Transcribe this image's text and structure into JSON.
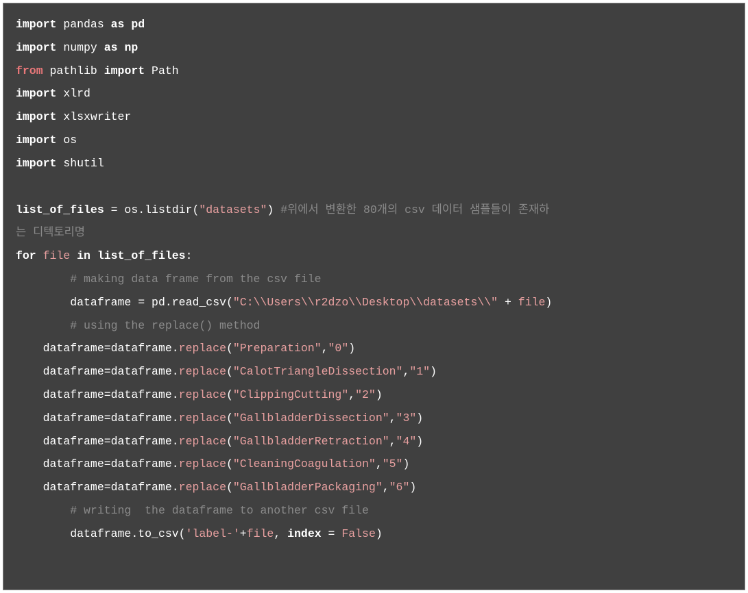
{
  "code": {
    "lines": [
      {
        "indent": "",
        "tokens": [
          {
            "cls": "kw-import",
            "t": "import"
          },
          {
            "cls": "ident",
            "t": " pandas "
          },
          {
            "cls": "kw-as",
            "t": "as"
          },
          {
            "cls": "alias",
            "t": " pd"
          }
        ]
      },
      {
        "indent": "",
        "tokens": [
          {
            "cls": "kw-import",
            "t": "import"
          },
          {
            "cls": "ident",
            "t": " numpy "
          },
          {
            "cls": "kw-as",
            "t": "as"
          },
          {
            "cls": "alias",
            "t": " np"
          }
        ]
      },
      {
        "indent": "",
        "tokens": [
          {
            "cls": "kw-from",
            "t": "from"
          },
          {
            "cls": "ident",
            "t": " pathlib "
          },
          {
            "cls": "kw-import",
            "t": "import"
          },
          {
            "cls": "ident",
            "t": " Path"
          }
        ]
      },
      {
        "indent": "",
        "tokens": [
          {
            "cls": "kw-import",
            "t": "import"
          },
          {
            "cls": "ident",
            "t": " xlrd"
          }
        ]
      },
      {
        "indent": "",
        "tokens": [
          {
            "cls": "kw-import",
            "t": "import"
          },
          {
            "cls": "ident",
            "t": " xlsxwriter"
          }
        ]
      },
      {
        "indent": "",
        "tokens": [
          {
            "cls": "kw-import",
            "t": "import"
          },
          {
            "cls": "ident",
            "t": " os"
          }
        ]
      },
      {
        "indent": "",
        "tokens": [
          {
            "cls": "kw-import",
            "t": "import"
          },
          {
            "cls": "ident",
            "t": " shutil"
          }
        ]
      },
      {
        "indent": "",
        "tokens": []
      },
      {
        "indent": "",
        "tokens": [
          {
            "cls": "ident-bold",
            "t": "list_of_files "
          },
          {
            "cls": "op",
            "t": "="
          },
          {
            "cls": "ident",
            "t": " os"
          },
          {
            "cls": "punct",
            "t": "."
          },
          {
            "cls": "ident",
            "t": "listdir"
          },
          {
            "cls": "paren",
            "t": "("
          },
          {
            "cls": "string",
            "t": "\"datasets\""
          },
          {
            "cls": "paren",
            "t": ")"
          },
          {
            "cls": "ident",
            "t": " "
          },
          {
            "cls": "comment",
            "t": "#위에서 변환한 80개의 csv 데이터 샘플들이 존재하"
          }
        ]
      },
      {
        "indent": "",
        "tokens": [
          {
            "cls": "comment",
            "t": "는 디텍토리명"
          }
        ]
      },
      {
        "indent": "",
        "tokens": [
          {
            "cls": "kw-for",
            "t": "for"
          },
          {
            "cls": "ident",
            "t": " "
          },
          {
            "cls": "var-file",
            "t": "file"
          },
          {
            "cls": "ident",
            "t": " "
          },
          {
            "cls": "kw-in",
            "t": "in"
          },
          {
            "cls": "ident-bold",
            "t": " list_of_files"
          },
          {
            "cls": "punct",
            "t": ":"
          }
        ]
      },
      {
        "indent": "        ",
        "tokens": [
          {
            "cls": "comment",
            "t": "# making data frame from the csv file"
          }
        ]
      },
      {
        "indent": "        ",
        "tokens": [
          {
            "cls": "ident",
            "t": "dataframe "
          },
          {
            "cls": "op",
            "t": "="
          },
          {
            "cls": "ident",
            "t": " pd"
          },
          {
            "cls": "punct",
            "t": "."
          },
          {
            "cls": "ident",
            "t": "read_csv"
          },
          {
            "cls": "paren",
            "t": "("
          },
          {
            "cls": "string",
            "t": "\"C:\\\\Users\\\\r2dzo\\\\Desktop\\\\datasets\\\\\""
          },
          {
            "cls": "ident",
            "t": " "
          },
          {
            "cls": "op",
            "t": "+"
          },
          {
            "cls": "ident",
            "t": " "
          },
          {
            "cls": "var-file",
            "t": "file"
          },
          {
            "cls": "paren",
            "t": ")"
          }
        ]
      },
      {
        "indent": "        ",
        "tokens": [
          {
            "cls": "comment",
            "t": "# using the replace() method"
          }
        ]
      },
      {
        "indent": "    ",
        "tokens": [
          {
            "cls": "ident",
            "t": "dataframe"
          },
          {
            "cls": "op",
            "t": "="
          },
          {
            "cls": "ident",
            "t": "dataframe"
          },
          {
            "cls": "punct",
            "t": "."
          },
          {
            "cls": "method",
            "t": "replace"
          },
          {
            "cls": "paren",
            "t": "("
          },
          {
            "cls": "string",
            "t": "\"Preparation\""
          },
          {
            "cls": "punct",
            "t": ","
          },
          {
            "cls": "string",
            "t": "\"0\""
          },
          {
            "cls": "paren",
            "t": ")"
          }
        ]
      },
      {
        "indent": "    ",
        "tokens": [
          {
            "cls": "ident",
            "t": "dataframe"
          },
          {
            "cls": "op",
            "t": "="
          },
          {
            "cls": "ident",
            "t": "dataframe"
          },
          {
            "cls": "punct",
            "t": "."
          },
          {
            "cls": "method",
            "t": "replace"
          },
          {
            "cls": "paren",
            "t": "("
          },
          {
            "cls": "string",
            "t": "\"CalotTriangleDissection\""
          },
          {
            "cls": "punct",
            "t": ","
          },
          {
            "cls": "string",
            "t": "\"1\""
          },
          {
            "cls": "paren",
            "t": ")"
          }
        ]
      },
      {
        "indent": "    ",
        "tokens": [
          {
            "cls": "ident",
            "t": "dataframe"
          },
          {
            "cls": "op",
            "t": "="
          },
          {
            "cls": "ident",
            "t": "dataframe"
          },
          {
            "cls": "punct",
            "t": "."
          },
          {
            "cls": "method",
            "t": "replace"
          },
          {
            "cls": "paren",
            "t": "("
          },
          {
            "cls": "string",
            "t": "\"ClippingCutting\""
          },
          {
            "cls": "punct",
            "t": ","
          },
          {
            "cls": "string",
            "t": "\"2\""
          },
          {
            "cls": "paren",
            "t": ")"
          }
        ]
      },
      {
        "indent": "    ",
        "tokens": [
          {
            "cls": "ident",
            "t": "dataframe"
          },
          {
            "cls": "op",
            "t": "="
          },
          {
            "cls": "ident",
            "t": "dataframe"
          },
          {
            "cls": "punct",
            "t": "."
          },
          {
            "cls": "method",
            "t": "replace"
          },
          {
            "cls": "paren",
            "t": "("
          },
          {
            "cls": "string",
            "t": "\"GallbladderDissection\""
          },
          {
            "cls": "punct",
            "t": ","
          },
          {
            "cls": "string",
            "t": "\"3\""
          },
          {
            "cls": "paren",
            "t": ")"
          }
        ]
      },
      {
        "indent": "    ",
        "tokens": [
          {
            "cls": "ident",
            "t": "dataframe"
          },
          {
            "cls": "op",
            "t": "="
          },
          {
            "cls": "ident",
            "t": "dataframe"
          },
          {
            "cls": "punct",
            "t": "."
          },
          {
            "cls": "method",
            "t": "replace"
          },
          {
            "cls": "paren",
            "t": "("
          },
          {
            "cls": "string",
            "t": "\"GallbladderRetraction\""
          },
          {
            "cls": "punct",
            "t": ","
          },
          {
            "cls": "string",
            "t": "\"4\""
          },
          {
            "cls": "paren",
            "t": ")"
          }
        ]
      },
      {
        "indent": "    ",
        "tokens": [
          {
            "cls": "ident",
            "t": "dataframe"
          },
          {
            "cls": "op",
            "t": "="
          },
          {
            "cls": "ident",
            "t": "dataframe"
          },
          {
            "cls": "punct",
            "t": "."
          },
          {
            "cls": "method",
            "t": "replace"
          },
          {
            "cls": "paren",
            "t": "("
          },
          {
            "cls": "string",
            "t": "\"CleaningCoagulation\""
          },
          {
            "cls": "punct",
            "t": ","
          },
          {
            "cls": "string",
            "t": "\"5\""
          },
          {
            "cls": "paren",
            "t": ")"
          }
        ]
      },
      {
        "indent": "    ",
        "tokens": [
          {
            "cls": "ident",
            "t": "dataframe"
          },
          {
            "cls": "op",
            "t": "="
          },
          {
            "cls": "ident",
            "t": "dataframe"
          },
          {
            "cls": "punct",
            "t": "."
          },
          {
            "cls": "method",
            "t": "replace"
          },
          {
            "cls": "paren",
            "t": "("
          },
          {
            "cls": "string",
            "t": "\"GallbladderPackaging\""
          },
          {
            "cls": "punct",
            "t": ","
          },
          {
            "cls": "string",
            "t": "\"6\""
          },
          {
            "cls": "paren",
            "t": ")"
          }
        ]
      },
      {
        "indent": "        ",
        "tokens": [
          {
            "cls": "comment",
            "t": "# writing  the dataframe to another csv file"
          }
        ]
      },
      {
        "indent": "        ",
        "tokens": [
          {
            "cls": "ident",
            "t": "dataframe"
          },
          {
            "cls": "punct",
            "t": "."
          },
          {
            "cls": "ident",
            "t": "to_csv"
          },
          {
            "cls": "paren",
            "t": "("
          },
          {
            "cls": "string",
            "t": "'label-'"
          },
          {
            "cls": "op",
            "t": "+"
          },
          {
            "cls": "var-file",
            "t": "file"
          },
          {
            "cls": "punct",
            "t": ","
          },
          {
            "cls": "ident-bold",
            "t": " index "
          },
          {
            "cls": "op",
            "t": "="
          },
          {
            "cls": "ident",
            "t": " "
          },
          {
            "cls": "const",
            "t": "False"
          },
          {
            "cls": "paren",
            "t": ")"
          }
        ]
      }
    ]
  }
}
